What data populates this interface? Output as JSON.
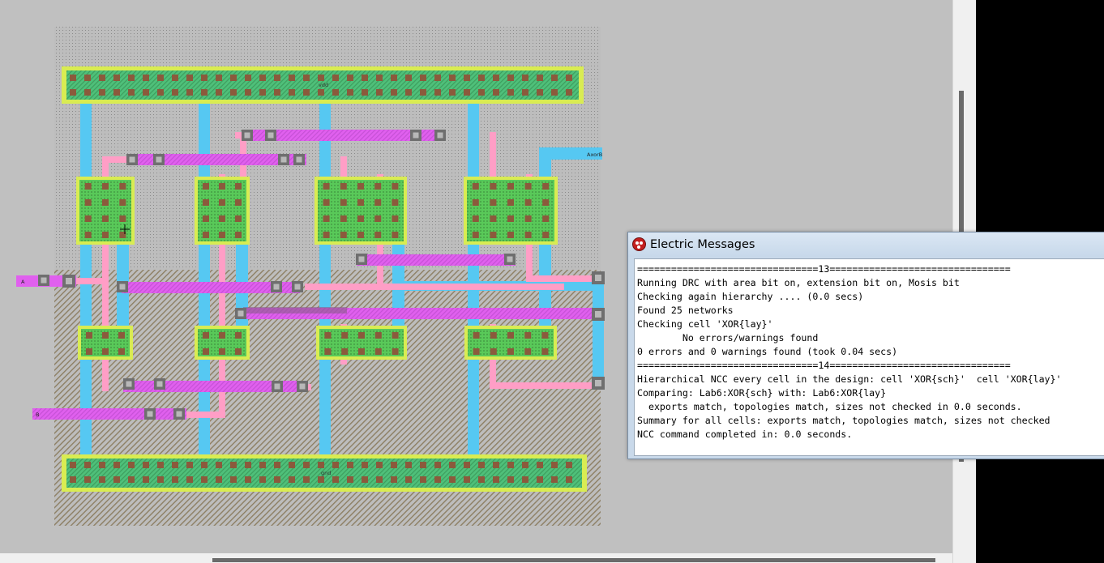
{
  "layout": {
    "labels": {
      "vdd": "vdd",
      "gnd": "gnd",
      "a": "A",
      "b": "B",
      "axorb": "AxorB"
    }
  },
  "messages": {
    "title": "Electric Messages",
    "lines": [
      "================================13================================",
      "Running DRC with area bit on, extension bit on, Mosis bit",
      "Checking again hierarchy .... (0.0 secs)",
      "Found 25 networks",
      "Checking cell 'XOR{lay}'",
      "        No errors/warnings found",
      "0 errors and 0 warnings found (took 0.04 secs)",
      "================================14================================",
      "Hierarchical NCC every cell in the design: cell 'XOR{sch}'  cell 'XOR{lay}'",
      "Comparing: Lab6:XOR{sch} with: Lab6:XOR{lay}",
      "  exports match, topologies match, sizes not checked in 0.0 seconds.",
      "Summary for all cells: exports match, topologies match, sizes not checked",
      "NCC command completed in: 0.0 seconds."
    ]
  },
  "colors": {
    "canvas_bg": "#c0c0c0",
    "metal1": "#56c8f2",
    "poly": "#ff9ec6",
    "metal2": "#e060ee",
    "active": "#59c959",
    "well": "#b7b7b7"
  }
}
